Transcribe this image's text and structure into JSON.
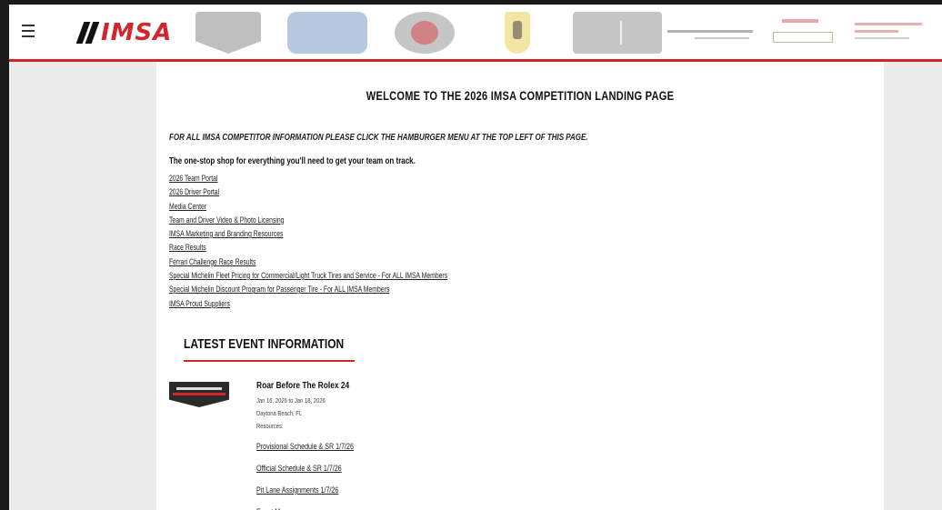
{
  "header": {
    "logo_text": "IMSA",
    "menu_icon": "hamburger-menu-icon",
    "partner_logos": [
      "series-logo-1",
      "series-logo-2",
      "series-logo-3",
      "ferrari-challenge-logo",
      "series-logo-5",
      "series-logo-6",
      "series-logo-7",
      "series-logo-8"
    ]
  },
  "main": {
    "title": "WELCOME TO THE 2026 IMSA COMPETITION LANDING PAGE",
    "notice": "FOR ALL IMSA COMPETITOR INFORMATION PLEASE CLICK THE HAMBURGER MENU AT THE TOP LEFT OF THIS PAGE.",
    "intro": "The one-stop shop for everything you'll need to get your team on track.",
    "links": [
      "2026 Team Portal",
      "2026 Driver Portal",
      "Media Center",
      "Team and Driver Video & Photo Licensing",
      "IMSA Marketing and Branding Resources",
      "Race Results",
      "Ferrari Challenge Race Results",
      "Special Michelin Fleet Pricing for Commercial/Light Truck Tires and Service - For ALL IMSA Members",
      "Special Michelin Discount Program for Passenger Tire - For ALL IMSA Members",
      "IMSA Proud Suppliers"
    ]
  },
  "latest": {
    "heading": "LATEST EVENT INFORMATION",
    "event": {
      "title": "Roar Before The Rolex 24",
      "dates": "Jan 16, 2026 to Jan 18, 2026",
      "location": "Daytona Beach, FL",
      "resources_label": "Resources:",
      "resources": [
        "Provisional Schedule & SR 1/7/26",
        "Official Schedule & SR 1/7/26",
        "Pit Lane Assignments 1/7/26",
        "Event Maps"
      ]
    }
  },
  "colors": {
    "accent": "#d4252c",
    "background": "#ececec",
    "panel": "#ffffff"
  }
}
